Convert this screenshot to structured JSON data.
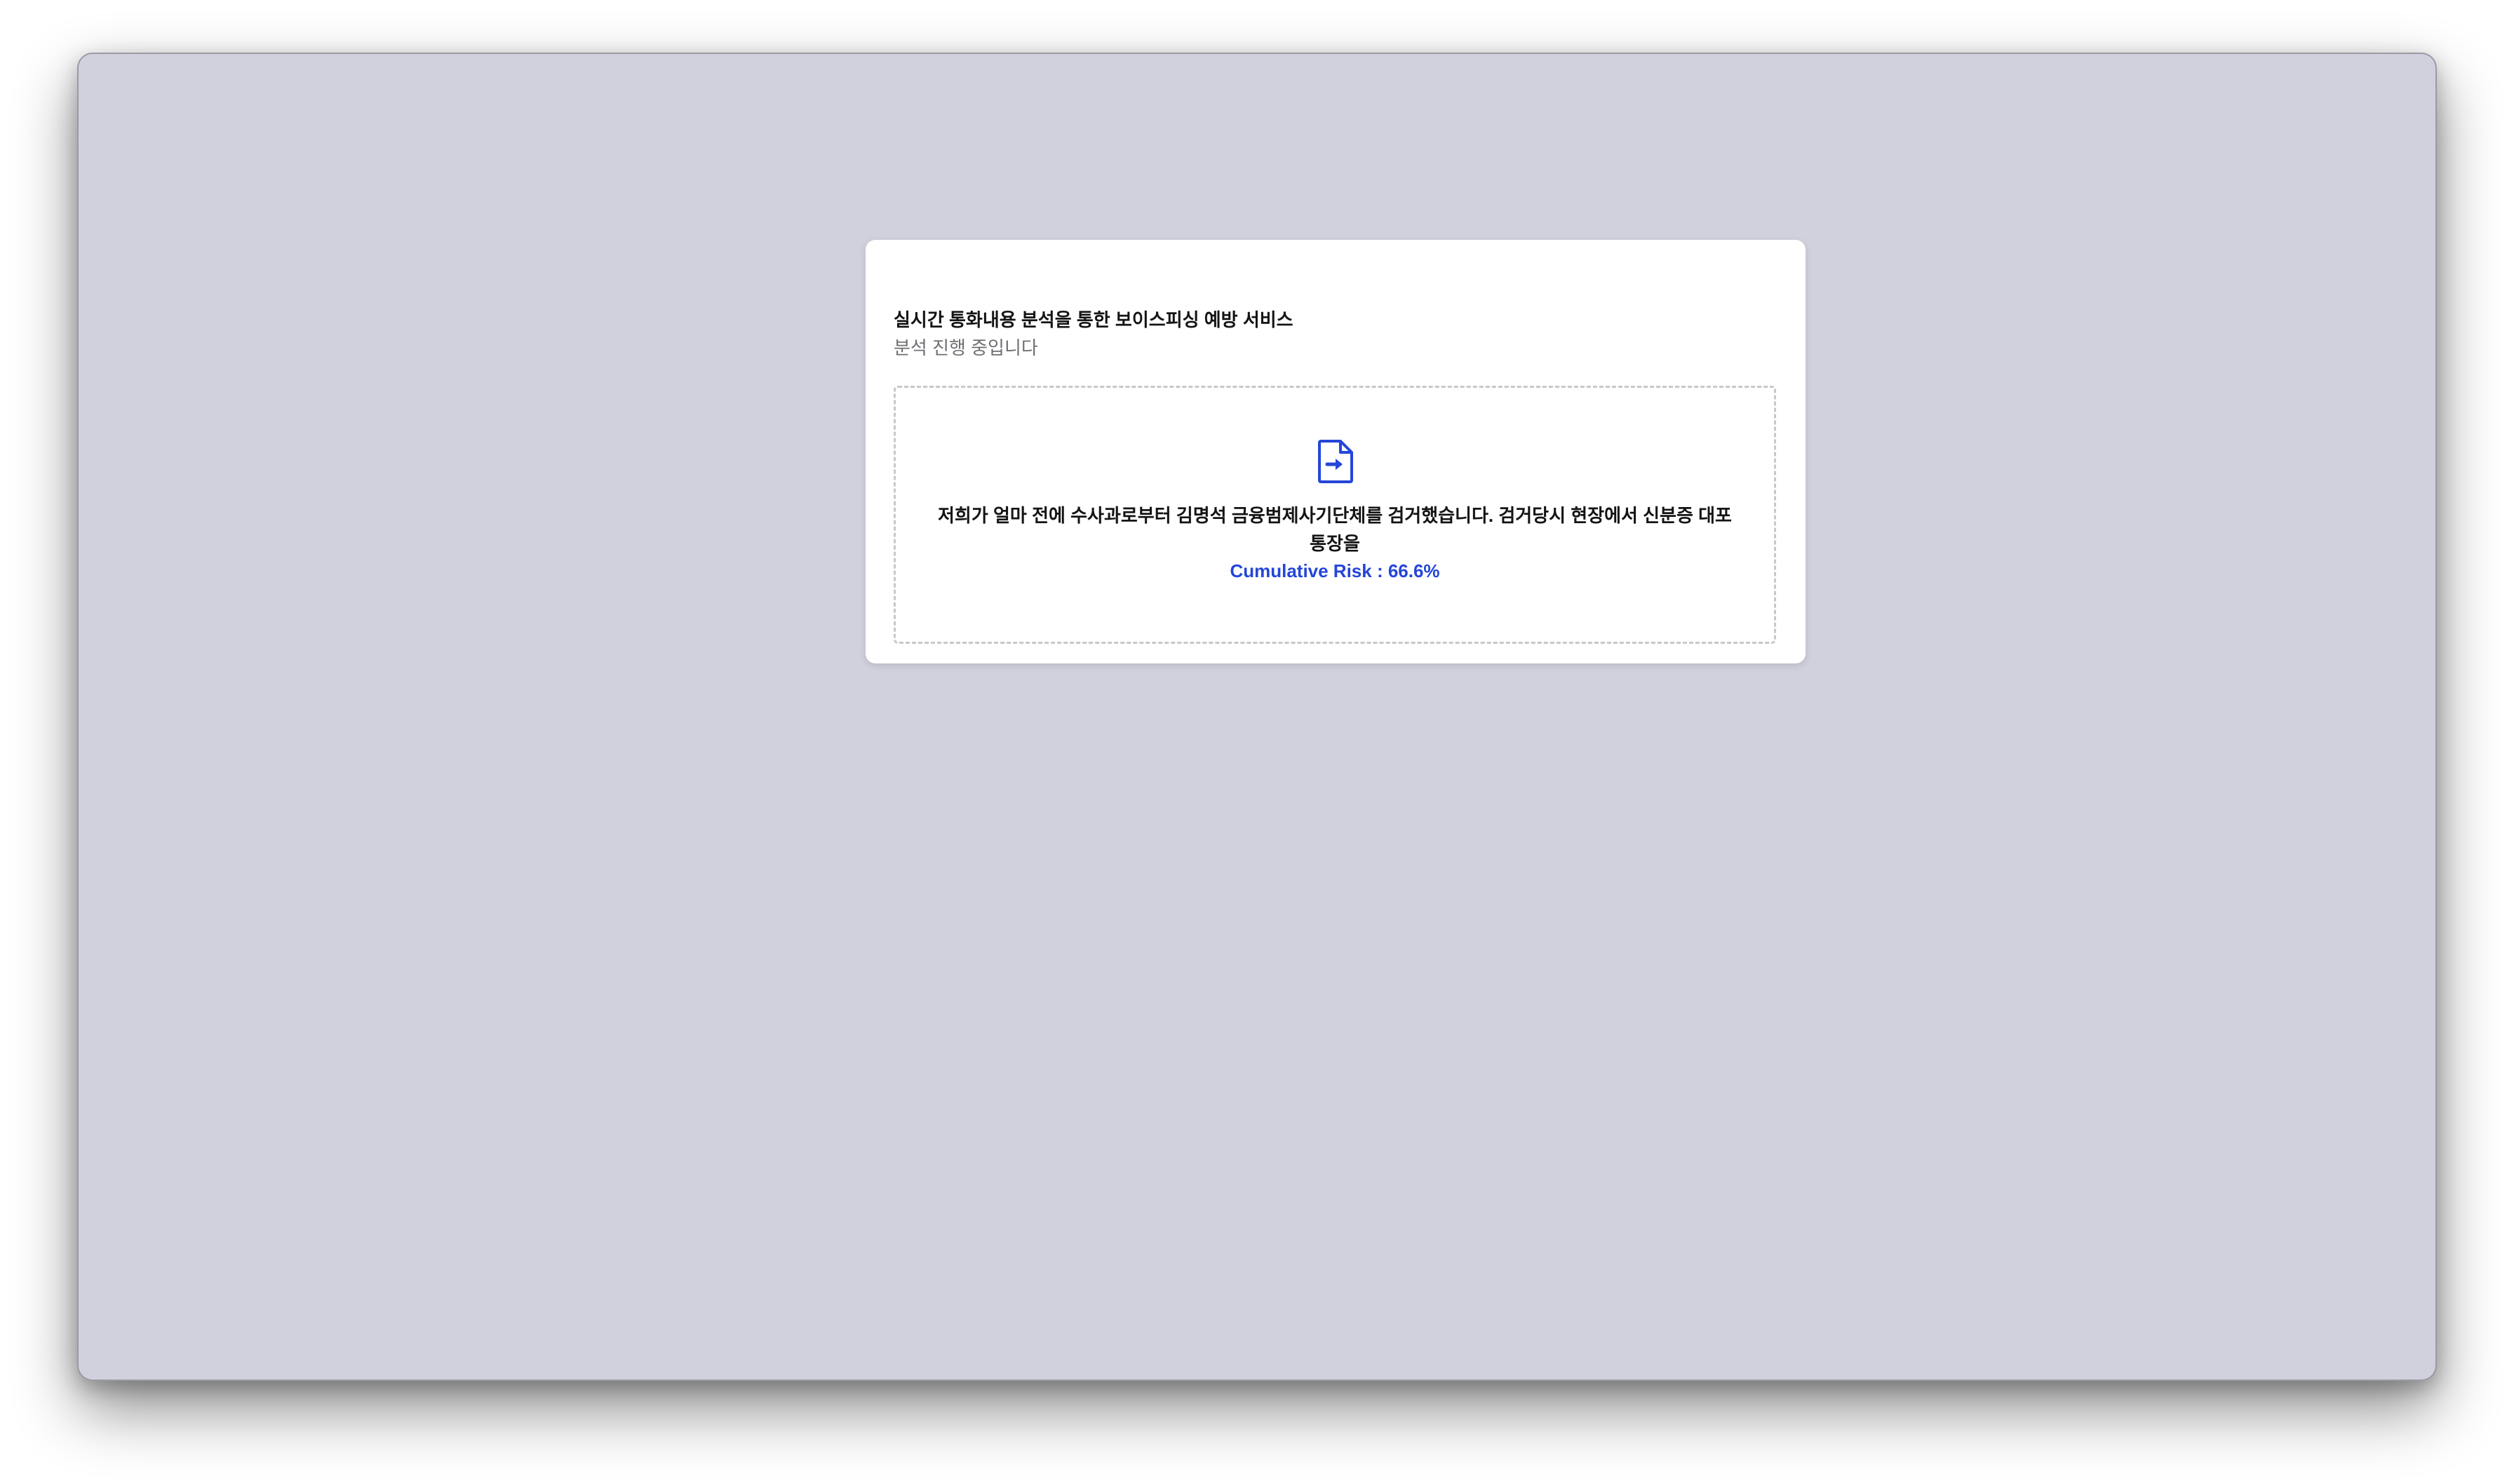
{
  "card": {
    "title": "실시간 통화내용 분석을 통한 보이스피싱 예방 서비스",
    "subtitle": "분석 진행 중입니다"
  },
  "dropzone": {
    "icon": "file-arrow-icon",
    "transcript": "저희가 얼마 전에 수사과로부터 김명석 금융범제사기단체를 검거했습니다. 검거당시 현장에서 신분증 대포 통장을",
    "risk_text": "Cumulative Risk : 66.6%",
    "risk_percent": 66.6
  },
  "colors": {
    "window_background": "#d1d1dd",
    "accent": "#2446d8",
    "card_background": "#ffffff"
  }
}
